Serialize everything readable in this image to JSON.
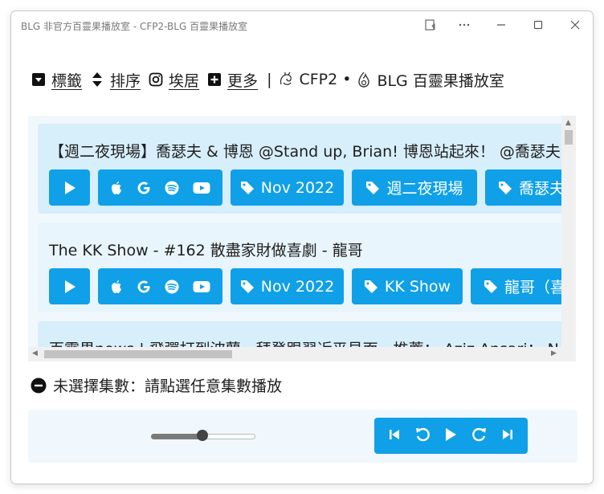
{
  "window": {
    "title": "BLG 非官方百靈果播放室 - CFP2-BLG 百靈果播放室",
    "controls": [
      "reader-icon",
      "more-icon",
      "minimize-icon",
      "maximize-icon",
      "close-icon"
    ]
  },
  "nav": {
    "tags_label": "標籤",
    "sort_label": "排序",
    "home_label": "埃居",
    "more_label": "更多",
    "separator": "|",
    "cfp_label": "CFP2",
    "dot": "•",
    "brand_label": "BLG 百靈果播放室"
  },
  "episodes": [
    {
      "title": "【週二夜現場】喬瑟夫 & 博恩 @Stand up, Brian! 博恩站起來！ @喬瑟夫",
      "tags": [
        "Nov 2022",
        "週二夜現場",
        "喬瑟夫"
      ]
    },
    {
      "title": "The KK Show - #162 散盡家財做喜劇 - 龍哥",
      "tags": [
        "Nov 2022",
        "KK Show",
        "龍哥（喜"
      ]
    },
    {
      "title": "百靈果news | 飛彈打到波蘭、拜登跟習近平見面、推薦： Aziz Ansari： N",
      "tags": []
    }
  ],
  "status": {
    "text": "未選擇集數：請點選任意集數播放"
  },
  "player": {
    "volume": 0.5,
    "buttons": [
      "skip-back-icon",
      "rewind-icon",
      "play-icon",
      "forward-icon",
      "skip-forward-icon"
    ]
  },
  "colors": {
    "accent": "#0fa0e8",
    "card_bg": "#d7eefb",
    "panel_bg": "#f1f8fd"
  }
}
